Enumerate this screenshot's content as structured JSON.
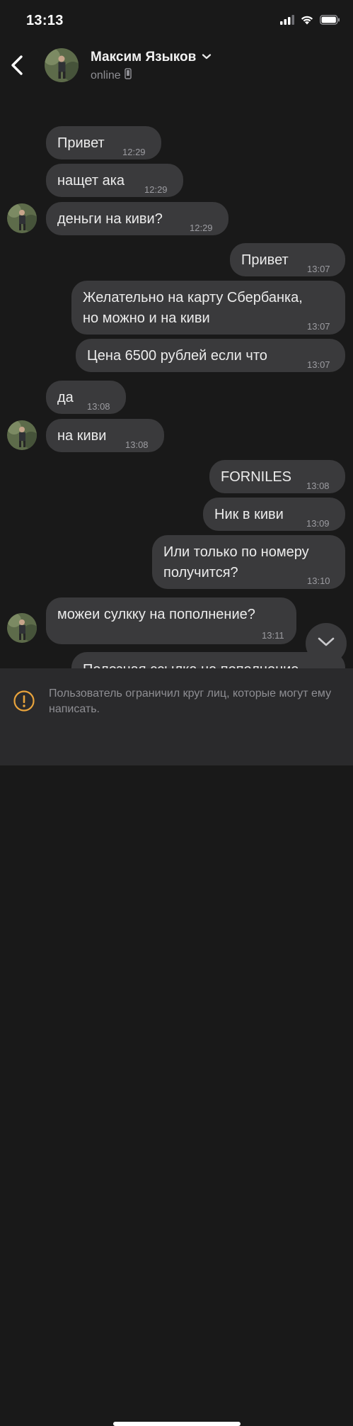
{
  "status_bar": {
    "time": "13:13",
    "icons": [
      "cellular-signal-icon",
      "wifi-icon",
      "battery-icon"
    ]
  },
  "header": {
    "back_icon": "chevron-left-icon",
    "contact_name": "Максим Языков",
    "status": "online",
    "status_icon": "phone-icon",
    "expand_icon": "chevron-down-icon"
  },
  "messages": [
    {
      "direction": "in",
      "text": "Привет",
      "time": "12:29",
      "avatar": false
    },
    {
      "direction": "in",
      "text": "нащет ака",
      "time": "12:29",
      "avatar": false
    },
    {
      "direction": "in",
      "text": "деньги на киви?",
      "time": "12:29",
      "avatar": true
    },
    {
      "direction": "out",
      "text": "Привет",
      "time": "13:07"
    },
    {
      "direction": "out",
      "text_lines": [
        "Желательно на карту Сбербанка,",
        "но можно и на киви"
      ],
      "time": "13:07"
    },
    {
      "direction": "out",
      "text": "Цена 6500 рублей если что",
      "time": "13:07"
    },
    {
      "direction": "in",
      "text": "да",
      "time": "13:08",
      "avatar": false
    },
    {
      "direction": "in",
      "text": "на киви",
      "time": "13:08",
      "avatar": true
    },
    {
      "direction": "out",
      "text": "FORNILES",
      "time": "13:08"
    },
    {
      "direction": "out",
      "text": "Ник в киви",
      "time": "13:09"
    },
    {
      "direction": "out",
      "text_lines": [
        "Или только по номеру",
        "получится?"
      ],
      "time": "13:10"
    },
    {
      "direction": "in",
      "text": "можеи сулкку на пополнение?",
      "time": "13:11",
      "avatar": true
    },
    {
      "direction": "out",
      "text": "Полезная ссылка на пополнение",
      "time": "",
      "partially_hidden": true
    }
  ],
  "scroll_down_icon": "chevron-down-icon",
  "restriction": {
    "icon": "warning-icon",
    "text": "Пользователь ограничил круг лиц, которые могут ему написать."
  },
  "colors": {
    "background": "#191919",
    "bubble": "#3a3a3c",
    "restriction_bar": "#2a2a2c",
    "warning_accent": "#e8a33c",
    "secondary_text": "#8e8e93"
  }
}
